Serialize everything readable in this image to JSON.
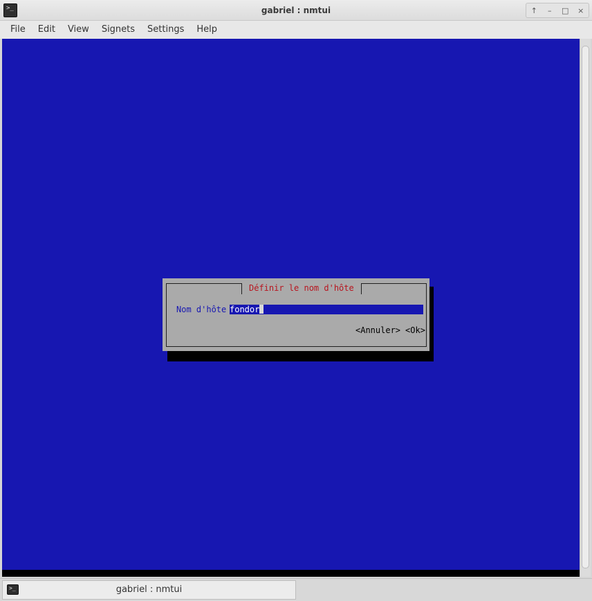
{
  "window": {
    "title": "gabriel : nmtui",
    "icon": "terminal-icon",
    "controls": {
      "above": "↑",
      "minimize": "–",
      "maximize": "□",
      "close": "×"
    }
  },
  "menubar": {
    "items": [
      "File",
      "Edit",
      "View",
      "Signets",
      "Settings",
      "Help"
    ]
  },
  "terminal": {
    "background_color": "#1717b1",
    "dialog": {
      "title": "Définir le nom d'hôte",
      "hostname_label": "Nom d'hôte",
      "hostname_value": "fondor",
      "cancel_button": "<Annuler>",
      "ok_button": "<Ok>",
      "title_color": "#b8151f",
      "body_color": "#aaaaaa"
    }
  },
  "taskbar": {
    "item_label": "gabriel : nmtui",
    "item_icon": "terminal-icon"
  }
}
